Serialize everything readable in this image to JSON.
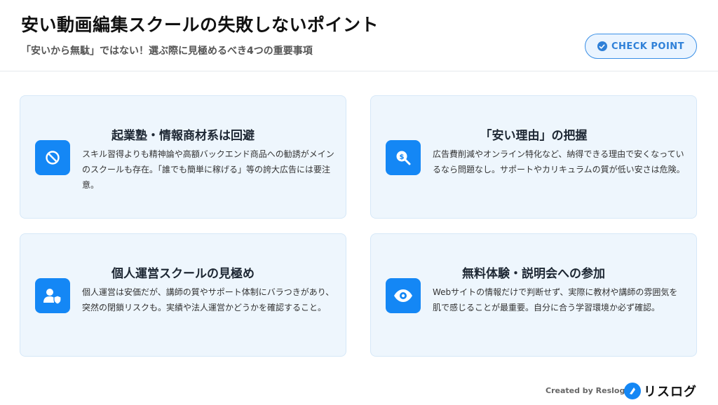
{
  "header": {
    "title": "安い動画編集スクールの失敗しないポイント",
    "subtitle": "「安いから無駄」ではない！選ぶ際に見極めるべき4つの重要事項",
    "check_label": "CHECK POINT"
  },
  "cards": [
    {
      "title": "起業塾・情報商材系は回避",
      "icon": "prohibited-icon",
      "desc": "スキル習得よりも精神論や高額バックエンド商品への勧誘がメインのスクールも存在。「誰でも簡単に稼げる」等の誇大広告には要注意。"
    },
    {
      "title": "「安い理由」の把握",
      "icon": "magnify-dollar-icon",
      "desc": "広告費削減やオンライン特化など、納得できる理由で安くなっているなら問題なし。サポートやカリキュラムの質が低い安さは危険。"
    },
    {
      "title": "個人運営スクールの見極め",
      "icon": "user-shield-icon",
      "desc": "個人運営は安価だが、講師の質やサポート体制にバラつきがあり、突然の閉鎖リスクも。実績や法人運営かどうかを確認すること。"
    },
    {
      "title": "無料体験・説明会への参加",
      "icon": "eye-icon",
      "desc": "Webサイトの情報だけで判断せず、実際に教材や講師の雰囲気を肌で感じることが最重要。自分に合う学習環境か必ず確認。"
    }
  ],
  "footer": {
    "credit": "Created by Reslog",
    "brand_name": "リスログ"
  },
  "colors": {
    "accent": "#1487f5",
    "card_bg": "#eef6fd",
    "card_border": "#d6e8f8"
  }
}
